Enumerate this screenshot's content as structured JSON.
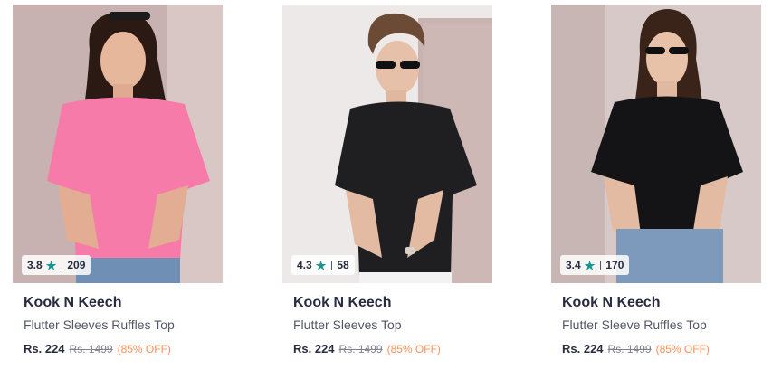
{
  "products": [
    {
      "rating": "3.8",
      "rating_count": "209",
      "brand": "Kook N Keech",
      "title": "Flutter Sleeves Ruffles Top",
      "price": "Rs. 224",
      "mrp": "Rs. 1499",
      "discount": "(85% OFF)",
      "image": {
        "background": "#c7b2b1",
        "top_color": "#f77ba8",
        "bottom_color": "#6f8fb5",
        "hair_color": "#2b1a14"
      }
    },
    {
      "rating": "4.3",
      "rating_count": "58",
      "brand": "Kook N Keech",
      "title": "Flutter Sleeves Top",
      "price": "Rs. 224",
      "mrp": "Rs. 1499",
      "discount": "(85% OFF)",
      "image": {
        "background": "#ece9e8",
        "top_color": "#1f1f22",
        "bottom_color": "#f2f2f2",
        "hair_color": "#6b4a36"
      }
    },
    {
      "rating": "3.4",
      "rating_count": "170",
      "brand": "Kook N Keech",
      "title": "Flutter Sleeve Ruffles Top",
      "price": "Rs. 224",
      "mrp": "Rs. 1499",
      "discount": "(85% OFF)",
      "image": {
        "background": "#d6c9c8",
        "top_color": "#141416",
        "bottom_color": "#7d99bb",
        "hair_color": "#3a241a"
      }
    }
  ],
  "colors": {
    "star": "#14958f",
    "brand_text": "#282c3f",
    "title_text": "#535766",
    "discount": "#ff905a"
  },
  "icons": {
    "rating": "star-icon"
  }
}
